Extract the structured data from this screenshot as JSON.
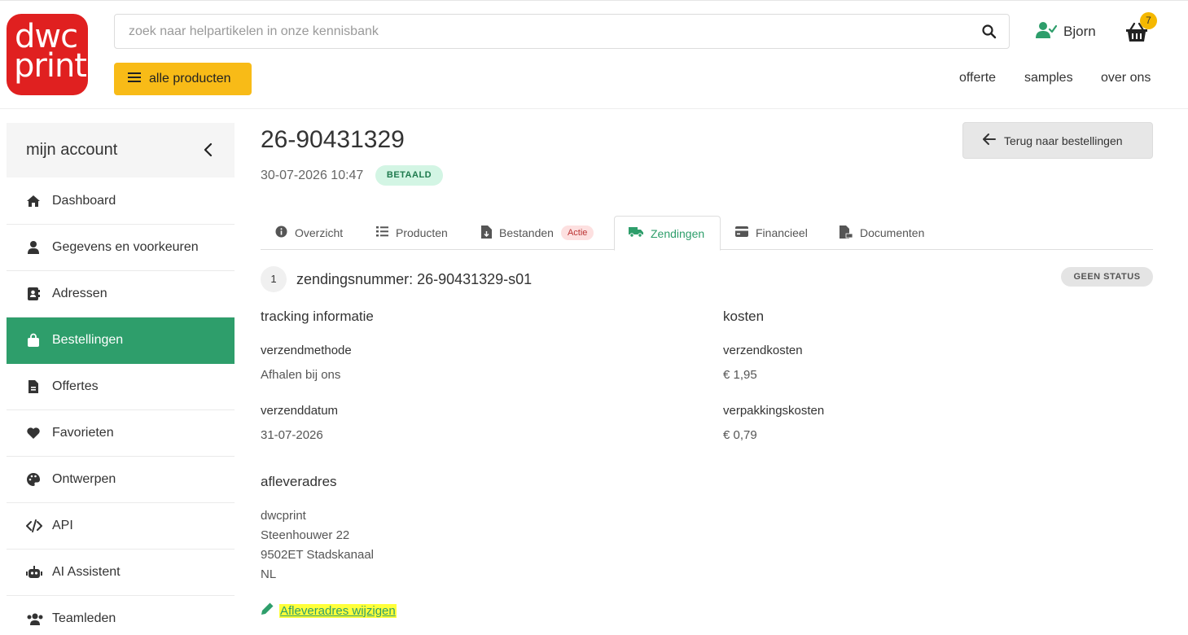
{
  "brand": {
    "line1": "dwc",
    "line2": "print"
  },
  "search": {
    "placeholder": "zoek naar helpartikelen in onze kennisbank"
  },
  "user": {
    "name": "Bjorn"
  },
  "cart": {
    "count": "7"
  },
  "menu_button": {
    "label": "alle producten"
  },
  "top_nav": [
    "offerte",
    "samples",
    "over ons"
  ],
  "sidebar": {
    "title": "mijn account",
    "items": [
      {
        "label": "Dashboard",
        "icon": "home-icon"
      },
      {
        "label": "Gegevens en voorkeuren",
        "icon": "user-icon"
      },
      {
        "label": "Adressen",
        "icon": "address-book-icon"
      },
      {
        "label": "Bestellingen",
        "icon": "shopping-bag-icon",
        "active": true
      },
      {
        "label": "Offertes",
        "icon": "document-icon"
      },
      {
        "label": "Favorieten",
        "icon": "heart-icon"
      },
      {
        "label": "Ontwerpen",
        "icon": "palette-icon"
      },
      {
        "label": "API",
        "icon": "code-icon"
      },
      {
        "label": "AI Assistent",
        "icon": "robot-icon"
      },
      {
        "label": "Teamleden",
        "icon": "users-icon"
      }
    ]
  },
  "order": {
    "number": "26-90431329",
    "datetime": "30-07-2026 10:47",
    "status_badge": "BETAALD",
    "back_button": "Terug naar bestellingen"
  },
  "tabs": [
    {
      "label": "Overzicht",
      "icon": "info-icon"
    },
    {
      "label": "Producten",
      "icon": "list-icon"
    },
    {
      "label": "Bestanden",
      "icon": "file-icon",
      "badge": "Actie"
    },
    {
      "label": "Zendingen",
      "icon": "truck-icon",
      "active": true
    },
    {
      "label": "Financieel",
      "icon": "credit-card-icon"
    },
    {
      "label": "Documenten",
      "icon": "pdf-icon"
    }
  ],
  "shipment": {
    "index": "1",
    "title": "zendingsnummer: 26-90431329-s01",
    "status": "GEEN STATUS",
    "tracking_heading": "tracking informatie",
    "method_label": "verzendmethode",
    "method_value": "Afhalen bij ons",
    "date_label": "verzenddatum",
    "date_value": "31-07-2026",
    "costs_heading": "kosten",
    "shipping_cost_label": "verzendkosten",
    "shipping_cost_value": "€ 1,95",
    "packaging_cost_label": "verpakkingskosten",
    "packaging_cost_value": "€ 0,79",
    "address_heading": "afleveradres",
    "address_lines": [
      "dwcprint",
      "Steenhouwer 22",
      "9502ET Stadskanaal",
      "NL"
    ],
    "edit_address_link": "Afleveradres wijzigen"
  },
  "colors": {
    "brand_red": "#e02020",
    "accent_yellow": "#f8bb17",
    "accent_green": "#2e9e6b"
  }
}
